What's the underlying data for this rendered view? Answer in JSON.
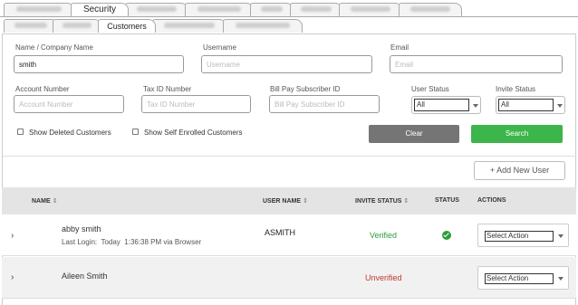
{
  "tabs": {
    "top": [
      {
        "label": "",
        "blurred": true
      },
      {
        "label": "Security",
        "blurred": false,
        "active": true
      },
      {
        "label": "",
        "blurred": true
      },
      {
        "label": "",
        "blurred": true
      },
      {
        "label": "",
        "blurred": true
      },
      {
        "label": "",
        "blurred": true
      },
      {
        "label": "",
        "blurred": true
      },
      {
        "label": "",
        "blurred": true
      }
    ],
    "sub": [
      {
        "label": "",
        "blurred": true
      },
      {
        "label": "",
        "blurred": true
      },
      {
        "label": "Customers",
        "blurred": false,
        "active": true
      },
      {
        "label": "",
        "blurred": true
      },
      {
        "label": "",
        "blurred": true
      }
    ]
  },
  "filters": {
    "name_label": "Name / Company Name",
    "name_value": "smith",
    "username_label": "Username",
    "username_placeholder": "Username",
    "email_label": "Email",
    "email_placeholder": "Email",
    "account_label": "Account Number",
    "account_placeholder": "Account Number",
    "taxid_label": "Tax ID Number",
    "taxid_placeholder": "Tax ID Number",
    "billpay_label": "Bill Pay Subscriber ID",
    "billpay_placeholder": "Bill Pay Subscriber ID",
    "user_status_label": "User Status",
    "user_status_value": "All",
    "invite_status_label": "Invite Status",
    "invite_status_value": "All",
    "show_deleted_label": "Show Deleted Customers",
    "show_self_enrolled_label": "Show Self Enrolled Customers",
    "clear_label": "Clear",
    "search_label": "Search"
  },
  "add_user_label": "+ Add New User",
  "table": {
    "headers": {
      "name": "NAME",
      "user_name": "USER NAME",
      "invite_status": "INVITE STATUS",
      "status": "STATUS",
      "actions": "ACTIONS"
    },
    "sort_glyph": "⇕",
    "rows": [
      {
        "name": "abby smith",
        "last_login_label": "Last Login:",
        "last_login_day": "Today",
        "last_login_detail": "1:36:38 PM via Browser",
        "user_name": "ASMITH",
        "invite_status": "Verified",
        "action": "Select Action"
      },
      {
        "name": "Aileen Smith",
        "user_name": "",
        "invite_status": "Unverified",
        "action": "Select Action"
      }
    ]
  },
  "colors": {
    "search_button": "#3cb54a",
    "clear_button": "#757575",
    "verified": "#2e9c3a",
    "unverified": "#c0392b",
    "header_bg": "#e4e4e4"
  }
}
